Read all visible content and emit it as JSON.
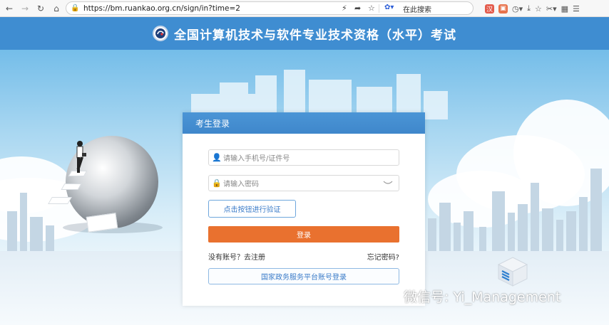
{
  "browser": {
    "url": "https://bm.ruankao.org.cn/sign/in?time=2",
    "search_placeholder": "在此搜索",
    "icons": [
      "back-icon",
      "forward-icon",
      "reload-icon",
      "home-icon",
      "lock-icon",
      "lightning-icon",
      "share-icon",
      "star-icon",
      "paw-icon",
      "translate-icon",
      "extension-icon",
      "history-icon",
      "download-icon",
      "favorites-icon",
      "screenshot-icon",
      "menu-icon"
    ]
  },
  "header": {
    "title": "全国计算机技术与软件专业技术资格（水平）考试"
  },
  "login": {
    "panel_title": "考生登录",
    "username_placeholder": "请输入手机号/证件号",
    "password_placeholder": "请输入密码",
    "verify_label": "点击按钮进行验证",
    "login_label": "登录",
    "register_text": "没有账号？去注册",
    "forgot_text": "忘记密码?",
    "gov_login_label": "国家政务服务平台账号登录"
  },
  "watermark": {
    "text": "微信号: Yi_Management"
  },
  "colors": {
    "header_blue": "#3f8dd1",
    "login_orange": "#e9712f",
    "link_blue": "#3a7bc8"
  }
}
